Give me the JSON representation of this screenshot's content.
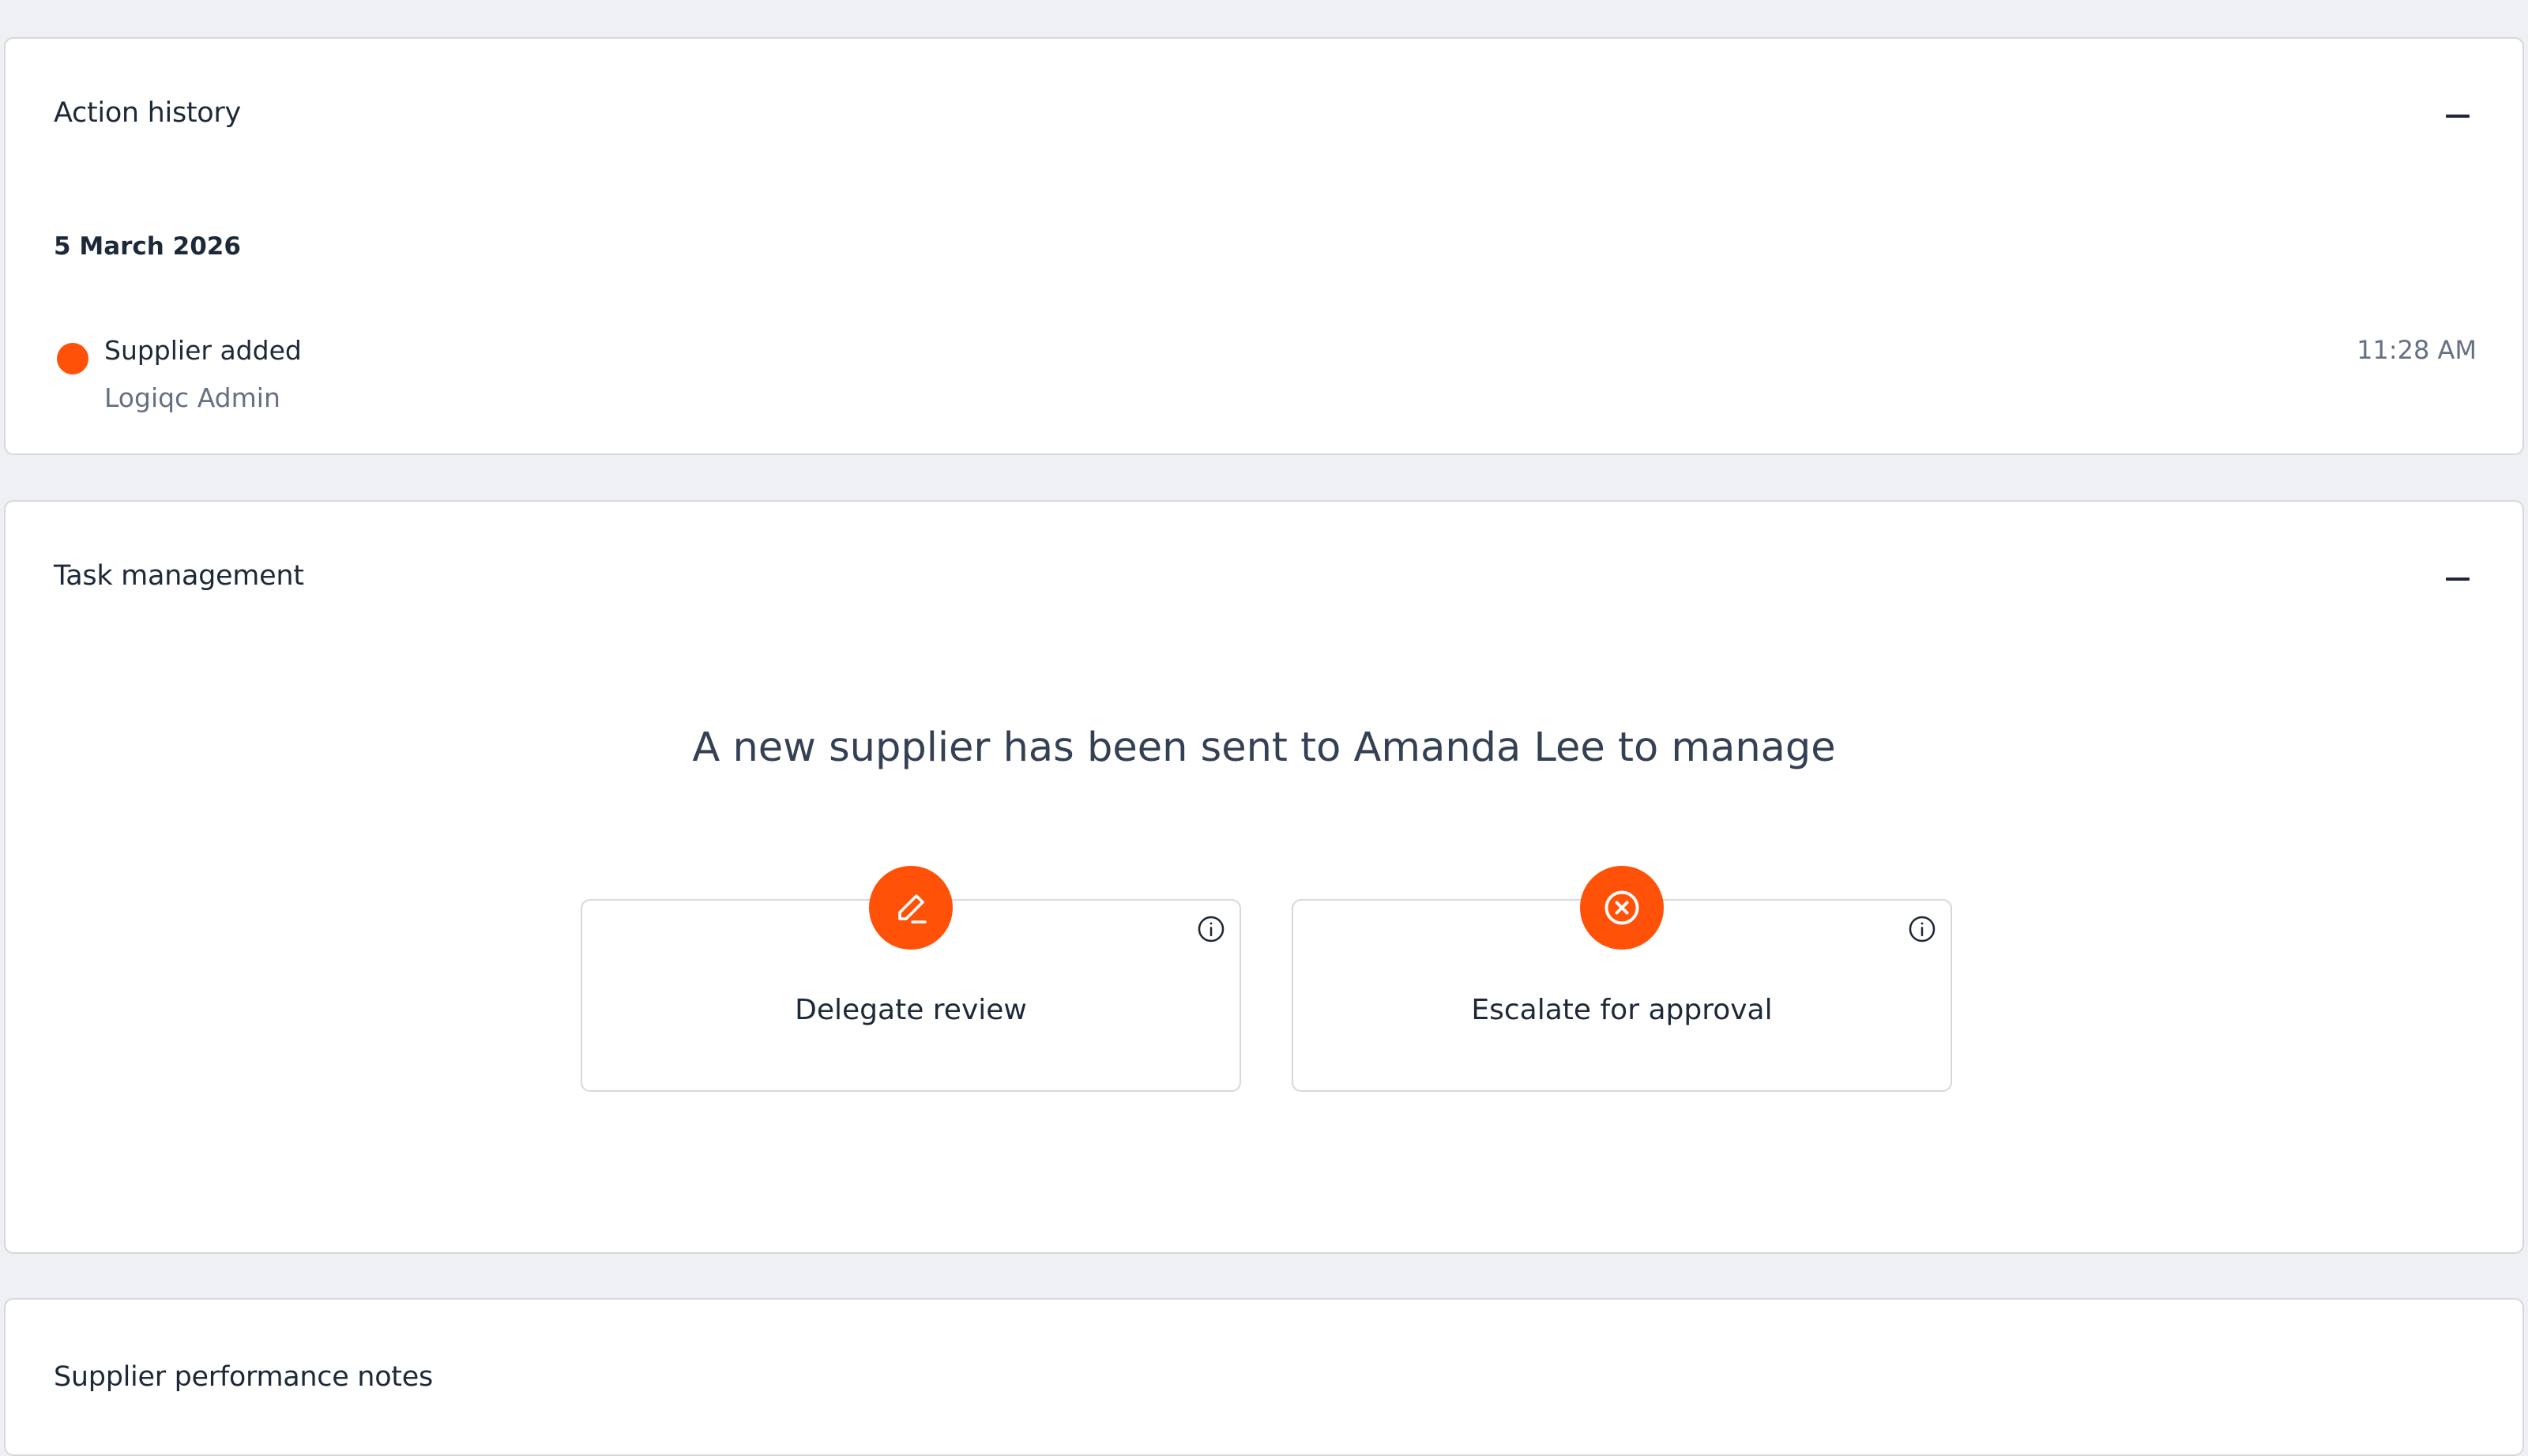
{
  "action_history": {
    "title": "Action history",
    "date": "5 March 2026",
    "events": [
      {
        "title": "Supplier added",
        "user": "Logiqc Admin",
        "time": "11:28 AM",
        "dot_color": "#ff5208"
      }
    ]
  },
  "task_management": {
    "title": "Task management",
    "message": "A new supplier has been sent to Amanda Lee to manage",
    "actions": [
      {
        "label": "Delegate review",
        "icon": "pencil-icon"
      },
      {
        "label": "Escalate for approval",
        "icon": "x-circle-icon"
      }
    ]
  },
  "performance_notes": {
    "title": "Supplier performance notes"
  },
  "colors": {
    "accent": "#ff5208",
    "background": "#eff0f3",
    "text": "#1d2939",
    "muted": "#667085"
  }
}
